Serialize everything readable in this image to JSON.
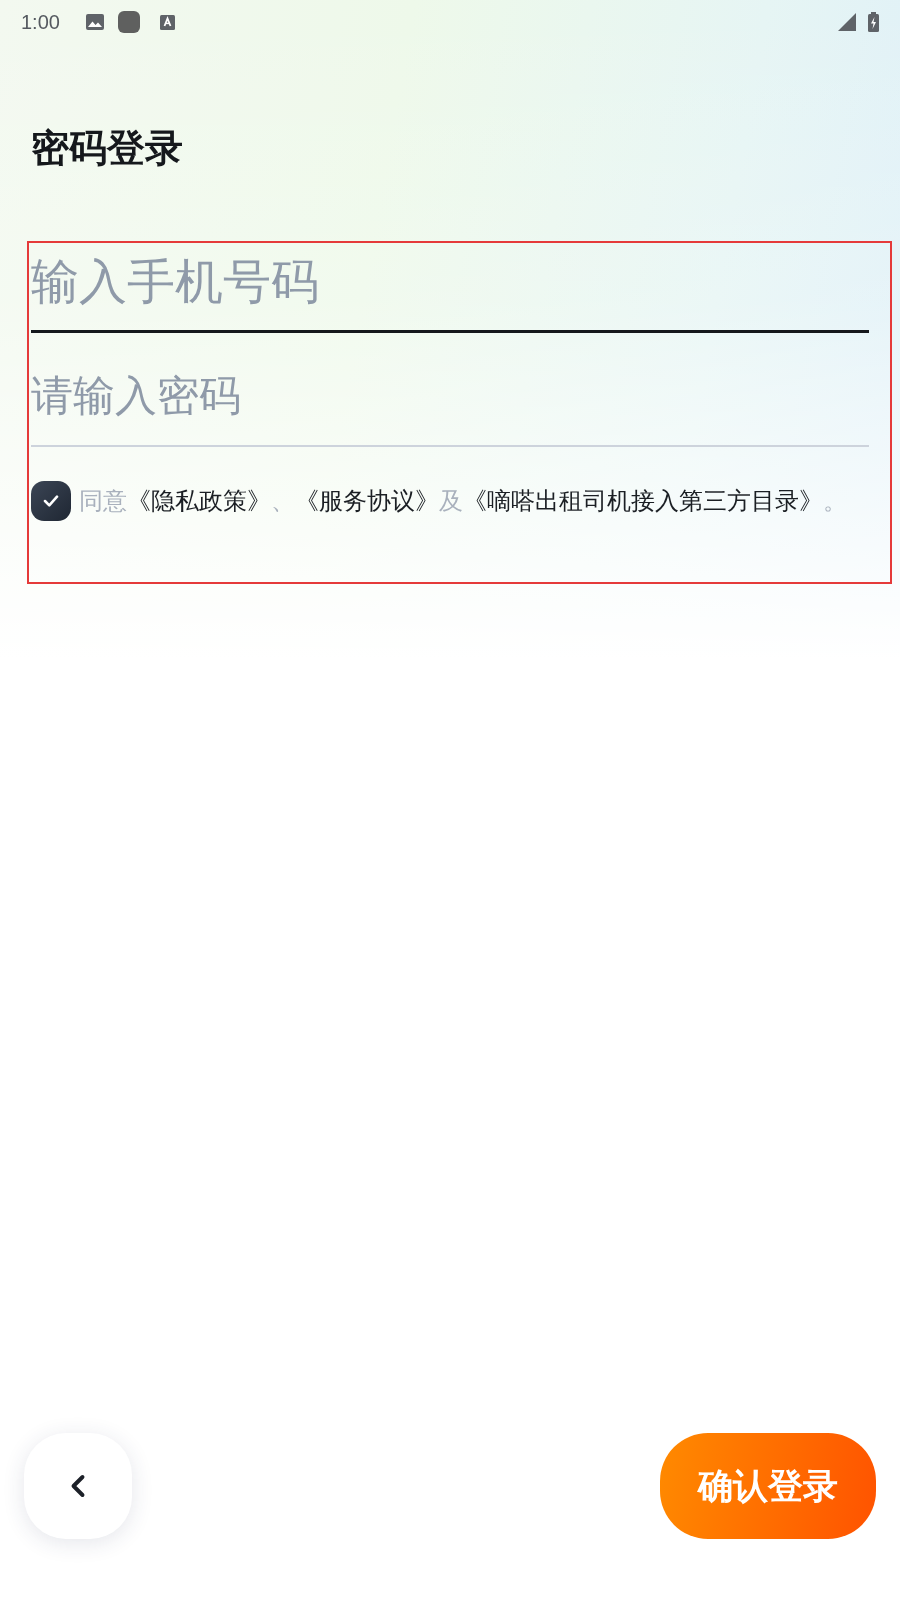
{
  "status_bar": {
    "time": "1:00"
  },
  "title": "密码登录",
  "form": {
    "highlighted": true,
    "phone_field": {
      "placeholder": "输入手机号码",
      "focused": true
    },
    "password_field": {
      "placeholder": "请输入密码",
      "focused": false
    },
    "agreement": {
      "checked": true,
      "parts": [
        {
          "kind": "plain",
          "text": "同意"
        },
        {
          "kind": "link",
          "text": "《隐私政策》"
        },
        {
          "kind": "plain",
          "text": "、"
        },
        {
          "kind": "link",
          "text": "《服务协议》"
        },
        {
          "kind": "plain",
          "text": "及"
        },
        {
          "kind": "link",
          "text": "《嘀嗒出租司机接入第三方目录》"
        },
        {
          "kind": "plain",
          "text": "。"
        }
      ]
    }
  },
  "confirm_button": {
    "label": "确认登录"
  }
}
